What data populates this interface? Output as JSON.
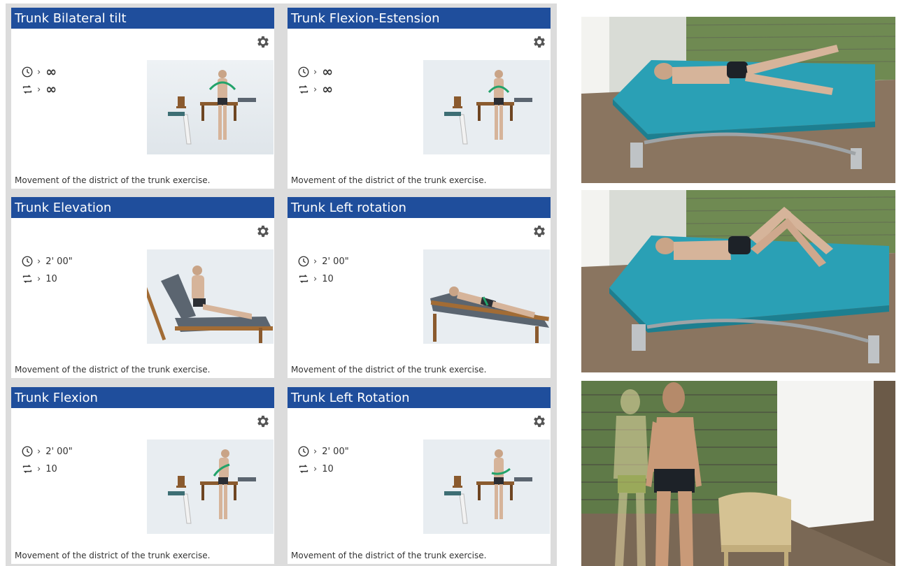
{
  "cards": [
    {
      "title": "Trunk Bilateral tilt",
      "duration": "∞",
      "repetitions": "∞",
      "description": "Movement of the district of the trunk exercise.",
      "illustration": "standing"
    },
    {
      "title": "Trunk Flexion-Estension",
      "duration": "∞",
      "repetitions": "∞",
      "description": "Movement of the district of the trunk exercise.",
      "illustration": "standing"
    },
    {
      "title": "Trunk Elevation",
      "duration": "2' 00\"",
      "repetitions": "10",
      "description": "Movement of the district of the trunk exercise.",
      "illustration": "sitting-lounger"
    },
    {
      "title": "Trunk Left rotation",
      "duration": "2' 00\"",
      "repetitions": "10",
      "description": "Movement of the district of the trunk exercise.",
      "illustration": "lying-lounger"
    },
    {
      "title": "Trunk Flexion",
      "duration": "2' 00\"",
      "repetitions": "10",
      "description": "Movement of the district of the trunk exercise.",
      "illustration": "standing"
    },
    {
      "title": "Trunk Left Rotation",
      "duration": "2' 00\"",
      "repetitions": "10",
      "description": "Movement of the district of the trunk exercise.",
      "illustration": "standing"
    }
  ],
  "icons": {
    "settings": "gear-icon",
    "duration": "clock-icon",
    "repetitions": "repeat-icon",
    "separator": "chevron-right-icon"
  },
  "colors": {
    "header": "#1f4e9c",
    "panel": "#dcdcdc",
    "bed": "#2aa0b5",
    "floor": "#8a7560"
  },
  "scenes": [
    {
      "view": "patient-lying-legs-straight"
    },
    {
      "view": "patient-lying-knees-bent"
    },
    {
      "view": "patient-standing-with-guide"
    }
  ]
}
